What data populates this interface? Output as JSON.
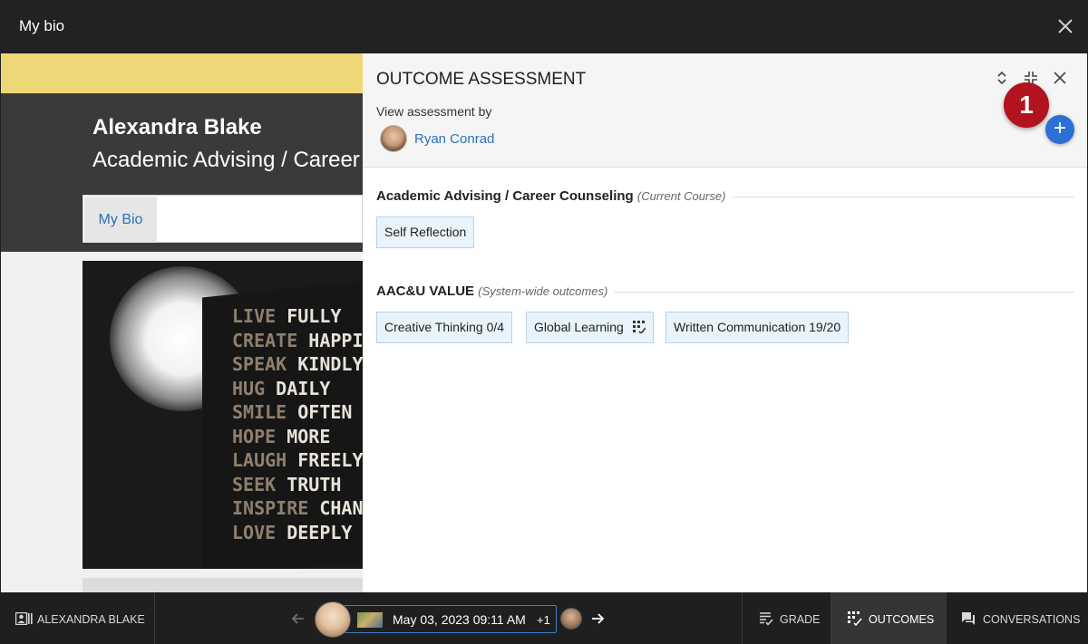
{
  "window": {
    "title": "My bio",
    "close_icon": "close-icon"
  },
  "profile": {
    "name": "Alexandra Blake",
    "course": "Academic Advising / Career Counseling",
    "nav_tab": "My Bio",
    "photo_words": [
      "LIVE",
      "FULLY",
      "CREATE",
      "HAPPIN",
      "SPEAK",
      "KINDLY",
      "HUG",
      "DAILY",
      "SMILE",
      "OFTEN",
      "HOPE",
      "MORE",
      "LAUGH",
      "FREELY",
      "SEEK",
      "TRUTH",
      "INSPIRE",
      "CHANG",
      "LOVE",
      "DEEPLY"
    ]
  },
  "panel": {
    "title": "OUTCOME ASSESSMENT",
    "view_by_label": "View assessment by",
    "assessor": "Ryan Conrad",
    "badge_count": "1",
    "add_label": "+",
    "sections": [
      {
        "title": "Academic Advising / Career Counseling",
        "subtitle": "(Current Course)",
        "chips": [
          {
            "label": "Self Reflection",
            "score": ""
          }
        ]
      },
      {
        "title": "AAC&U VALUE",
        "subtitle": "(System-wide outcomes)",
        "chips": [
          {
            "label": "Creative Thinking",
            "score": "0/4"
          },
          {
            "label": "Global Learning",
            "score": ""
          },
          {
            "label": "Written Communication",
            "score": "19/20"
          }
        ]
      }
    ]
  },
  "bottom": {
    "student_label": "ALEXANDRA BLAKE",
    "submission_date": "May 03, 2023 09:11 AM",
    "more_count": "+1",
    "tabs": {
      "grade": "GRADE",
      "outcomes": "OUTCOMES",
      "conversations": "CONVERSATIONS"
    }
  },
  "colors": {
    "accent": "#2e6fb6",
    "badge": "#b3121f",
    "add_button": "#2c6fd6",
    "banner": "#efd777",
    "chip_bg": "#e8f3fc"
  }
}
